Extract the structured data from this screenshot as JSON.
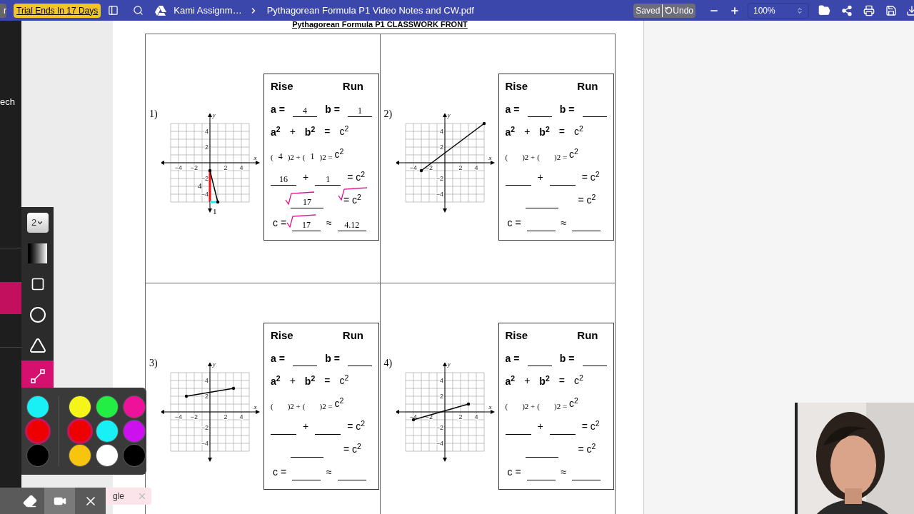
{
  "left_chip": "r",
  "topbar": {
    "trial": "Trial Ends In 17 Days",
    "breadcrumb": "Kami Assignm…",
    "file": "Pythagorean Formula P1 Video Notes and CW.pdf",
    "saved": "Saved",
    "undo": "Undo",
    "zoom": "100%"
  },
  "side_panel": {
    "text": "ech"
  },
  "tools": [
    {
      "kind": "size",
      "label": "2",
      "selected": false
    },
    {
      "kind": "gradient",
      "selected": false
    },
    {
      "kind": "rectangle",
      "selected": false
    },
    {
      "kind": "circle",
      "selected": false
    },
    {
      "kind": "triangle",
      "selected": false
    },
    {
      "kind": "line",
      "selected": true
    }
  ],
  "recent_colors": [
    {
      "color": "#19f0f5",
      "selected": false
    },
    {
      "color": "#ee0000",
      "selected": true
    },
    {
      "color": "#000000",
      "selected": false
    }
  ],
  "colors": [
    {
      "color": "#f5f51a",
      "selected": false
    },
    {
      "color": "#22ee44",
      "selected": false
    },
    {
      "color": "#ee1199",
      "selected": false
    },
    {
      "color": "#ee0000",
      "selected": true
    },
    {
      "color": "#19f0f5",
      "selected": false
    },
    {
      "color": "#cc11ee",
      "selected": false
    },
    {
      "color": "#f7c50d",
      "selected": false
    },
    {
      "color": "#ffffff",
      "selected": false
    },
    {
      "color": "#000000",
      "selected": false
    }
  ],
  "tab_pill": {
    "text": "gle"
  },
  "worksheet": {
    "title": "Pythagorean Formula P1 CLASSWORK FRONT",
    "problems": [
      {
        "number": "1)",
        "graph": {
          "x_label": "x",
          "y_label": "y",
          "x_ticks": [
            "−4",
            "−2",
            "2",
            "4"
          ],
          "y_ticks": [
            "4",
            "2",
            "−2",
            "−4"
          ],
          "marked": true,
          "rise_label": "4",
          "run_label": "1"
        },
        "rows": [
          {
            "tokens": [
              {
                "kind": "head",
                "text": "Rise"
              },
              {
                "kind": "head",
                "text": "Run"
              }
            ]
          },
          {
            "tokens": [
              {
                "kind": "var",
                "text": "a ="
              },
              {
                "kind": "blank",
                "value": "4"
              },
              {
                "kind": "var",
                "text": "b ="
              },
              {
                "kind": "blank",
                "value": "1"
              }
            ]
          },
          {
            "tokens": [
              {
                "kind": "var",
                "text": "a$^{2}$"
              },
              {
                "kind": "text",
                "text": "+"
              },
              {
                "kind": "var",
                "text": "b$^{2}$"
              },
              {
                "kind": "text",
                "text": "="
              },
              {
                "kind": "text",
                "text": "c$^{2}$"
              }
            ]
          },
          {
            "tokens": [
              {
                "kind": "small",
                "text": "("
              },
              {
                "kind": "fill",
                "value": "4"
              },
              {
                "kind": "small",
                "text": ")2 +"
              },
              {
                "kind": "small",
                "text": "("
              },
              {
                "kind": "fill",
                "value": "1"
              },
              {
                "kind": "small",
                "text": ")2 ="
              },
              {
                "kind": "text",
                "text": "c$^{2}$"
              }
            ]
          },
          {
            "tokens": [
              {
                "kind": "blank",
                "value": "16"
              },
              {
                "kind": "text",
                "text": "+"
              },
              {
                "kind": "blank",
                "value": "1"
              },
              {
                "kind": "text",
                "text": "= c$^{2}$"
              }
            ]
          },
          {
            "tokens": [
              {
                "kind": "blank",
                "value": "17",
                "root": true
              },
              {
                "kind": "text",
                "text": "= c$^{2}$",
                "root": true
              }
            ]
          },
          {
            "tokens": [
              {
                "kind": "text",
                "text": "c ="
              },
              {
                "kind": "blank",
                "value": "17",
                "root": true
              },
              {
                "kind": "text",
                "text": "≈"
              },
              {
                "kind": "blank",
                "value": "4.12"
              }
            ]
          }
        ]
      },
      {
        "number": "2)",
        "graph": {
          "x_label": "x",
          "y_label": "y",
          "x_ticks": [
            "−4",
            "−2",
            "2",
            "4"
          ],
          "y_ticks": [
            "4",
            "2",
            "−2",
            "−4"
          ],
          "marked": false
        },
        "rows": [
          {
            "tokens": [
              {
                "kind": "head",
                "text": "Rise"
              },
              {
                "kind": "head",
                "text": "Run"
              }
            ]
          },
          {
            "tokens": [
              {
                "kind": "var",
                "text": "a ="
              },
              {
                "kind": "blank"
              },
              {
                "kind": "var",
                "text": "b ="
              },
              {
                "kind": "blank"
              }
            ]
          },
          {
            "tokens": [
              {
                "kind": "var",
                "text": "a$^{2}$"
              },
              {
                "kind": "text",
                "text": "+"
              },
              {
                "kind": "var",
                "text": "b$^{2}$"
              },
              {
                "kind": "text",
                "text": "="
              },
              {
                "kind": "text",
                "text": "c$^{2}$"
              }
            ]
          },
          {
            "tokens": [
              {
                "kind": "small",
                "text": "("
              },
              {
                "kind": "fill"
              },
              {
                "kind": "small",
                "text": ")2 +"
              },
              {
                "kind": "small",
                "text": "("
              },
              {
                "kind": "fill"
              },
              {
                "kind": "small",
                "text": ")2 ="
              },
              {
                "kind": "text",
                "text": "c$^{2}$"
              }
            ]
          },
          {
            "tokens": [
              {
                "kind": "blank"
              },
              {
                "kind": "text",
                "text": "+"
              },
              {
                "kind": "blank"
              },
              {
                "kind": "text",
                "text": "= c$^{2}$"
              }
            ]
          },
          {
            "tokens": [
              {
                "kind": "blank",
                "root": false
              },
              {
                "kind": "text",
                "text": "= c$^{2}$",
                "root": false
              }
            ]
          },
          {
            "tokens": [
              {
                "kind": "text",
                "text": "c ="
              },
              {
                "kind": "blank",
                "root": false
              },
              {
                "kind": "text",
                "text": "≈"
              },
              {
                "kind": "blank"
              }
            ]
          }
        ]
      },
      {
        "number": "3)",
        "graph": {
          "x_label": "x",
          "y_label": "y",
          "x_ticks": [
            "−4",
            "−2",
            "2",
            "4"
          ],
          "y_ticks": [
            "4",
            "2",
            "−2",
            "−4"
          ],
          "marked": false
        },
        "rows": [
          {
            "tokens": [
              {
                "kind": "head",
                "text": "Rise"
              },
              {
                "kind": "head",
                "text": "Run"
              }
            ]
          },
          {
            "tokens": [
              {
                "kind": "var",
                "text": "a ="
              },
              {
                "kind": "blank"
              },
              {
                "kind": "var",
                "text": "b ="
              },
              {
                "kind": "blank"
              }
            ]
          },
          {
            "tokens": [
              {
                "kind": "var",
                "text": "a$^{2}$"
              },
              {
                "kind": "text",
                "text": "+"
              },
              {
                "kind": "var",
                "text": "b$^{2}$"
              },
              {
                "kind": "text",
                "text": "="
              },
              {
                "kind": "text",
                "text": "c$^{2}$"
              }
            ]
          },
          {
            "tokens": [
              {
                "kind": "small",
                "text": "("
              },
              {
                "kind": "fill"
              },
              {
                "kind": "small",
                "text": ")2 +"
              },
              {
                "kind": "small",
                "text": "("
              },
              {
                "kind": "fill"
              },
              {
                "kind": "small",
                "text": ")2 ="
              },
              {
                "kind": "text",
                "text": "c$^{2}$"
              }
            ]
          },
          {
            "tokens": [
              {
                "kind": "blank"
              },
              {
                "kind": "text",
                "text": "+"
              },
              {
                "kind": "blank"
              },
              {
                "kind": "text",
                "text": "= c$^{2}$"
              }
            ]
          },
          {
            "tokens": [
              {
                "kind": "blank",
                "root": false
              },
              {
                "kind": "text",
                "text": "= c$^{2}$",
                "root": false
              }
            ]
          },
          {
            "tokens": [
              {
                "kind": "text",
                "text": "c ="
              },
              {
                "kind": "blank",
                "root": false
              },
              {
                "kind": "text",
                "text": "≈"
              },
              {
                "kind": "blank"
              }
            ]
          }
        ]
      },
      {
        "number": "4)",
        "graph": {
          "x_label": "x",
          "y_label": "y",
          "x_ticks": [
            "−4",
            "−2",
            "2",
            "4"
          ],
          "y_ticks": [
            "4",
            "2",
            "−2",
            "−4"
          ],
          "marked": false
        },
        "rows": [
          {
            "tokens": [
              {
                "kind": "head",
                "text": "Rise"
              },
              {
                "kind": "head",
                "text": "Run"
              }
            ]
          },
          {
            "tokens": [
              {
                "kind": "var",
                "text": "a ="
              },
              {
                "kind": "blank"
              },
              {
                "kind": "var",
                "text": "b ="
              },
              {
                "kind": "blank"
              }
            ]
          },
          {
            "tokens": [
              {
                "kind": "var",
                "text": "a$^{2}$"
              },
              {
                "kind": "text",
                "text": "+"
              },
              {
                "kind": "var",
                "text": "b$^{2}$"
              },
              {
                "kind": "text",
                "text": "="
              },
              {
                "kind": "text",
                "text": "c$^{2}$"
              }
            ]
          },
          {
            "tokens": [
              {
                "kind": "small",
                "text": "("
              },
              {
                "kind": "fill"
              },
              {
                "kind": "small",
                "text": ")2 +"
              },
              {
                "kind": "small",
                "text": "("
              },
              {
                "kind": "fill"
              },
              {
                "kind": "small",
                "text": ")2 ="
              },
              {
                "kind": "text",
                "text": "c$^{2}$"
              }
            ]
          },
          {
            "tokens": [
              {
                "kind": "blank"
              },
              {
                "kind": "text",
                "text": "+"
              },
              {
                "kind": "blank"
              },
              {
                "kind": "text",
                "text": "= c$^{2}$"
              }
            ]
          },
          {
            "tokens": [
              {
                "kind": "blank",
                "root": false
              },
              {
                "kind": "text",
                "text": "= c$^{2}$",
                "root": false
              }
            ]
          },
          {
            "tokens": [
              {
                "kind": "text",
                "text": "c ="
              },
              {
                "kind": "blank",
                "root": false
              },
              {
                "kind": "text",
                "text": "≈"
              },
              {
                "kind": "blank"
              }
            ]
          }
        ]
      }
    ]
  }
}
